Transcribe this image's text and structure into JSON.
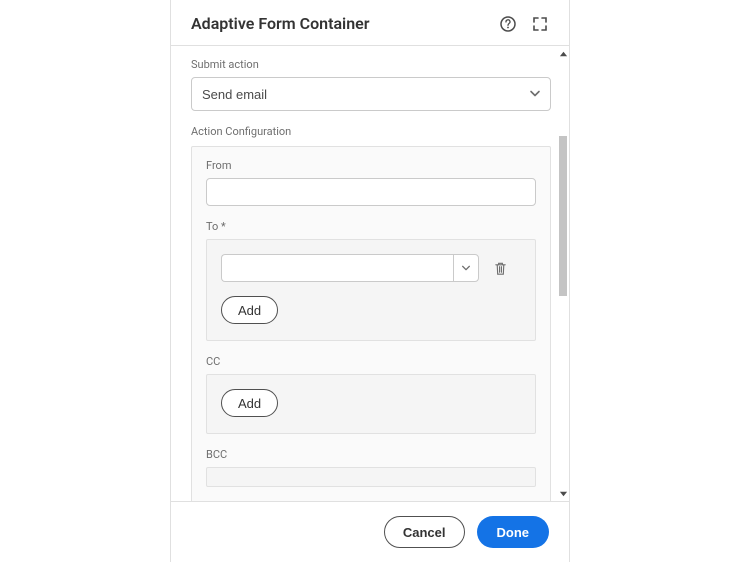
{
  "header": {
    "title": "Adaptive Form Container"
  },
  "submit": {
    "label": "Submit action",
    "selected": "Send email"
  },
  "actionConfig": {
    "label": "Action Configuration",
    "from": {
      "label": "From",
      "value": ""
    },
    "to": {
      "label": "To *",
      "value": "",
      "addLabel": "Add"
    },
    "cc": {
      "label": "CC",
      "addLabel": "Add"
    },
    "bcc": {
      "label": "BCC"
    }
  },
  "footer": {
    "cancel": "Cancel",
    "done": "Done"
  }
}
